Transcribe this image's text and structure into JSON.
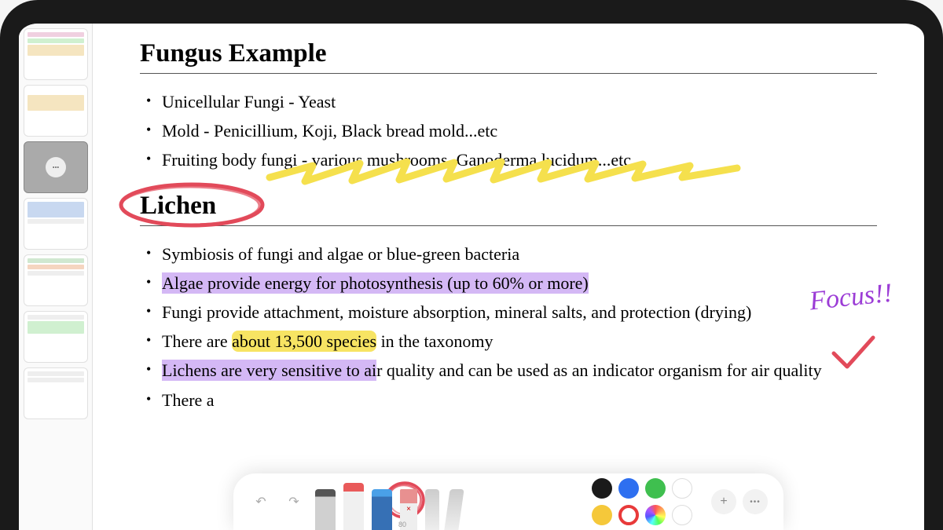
{
  "sidebar": {
    "thumbnails": [
      {
        "selected": false
      },
      {
        "selected": false
      },
      {
        "selected": true
      },
      {
        "selected": false
      },
      {
        "selected": false
      },
      {
        "selected": false
      },
      {
        "selected": false
      }
    ]
  },
  "document": {
    "section1": {
      "heading": "Fungus Example",
      "bullets": [
        "Unicellular Fungi - Yeast",
        "Mold - Penicillium, Koji, Black bread mold...etc",
        "Fruiting body fungi - various mushrooms, Ganoderma lucidum...etc"
      ]
    },
    "section2": {
      "heading": "Lichen",
      "bullets": [
        {
          "text": "Symbiosis of fungi and algae or blue-green bacteria",
          "highlight": null
        },
        {
          "text": "Algae provide energy for photosynthesis (up to 60% or more)",
          "highlight": "purple"
        },
        {
          "text_pre": "Fungi provide attachment, moisture absorption, mineral salts, and protection (drying)",
          "highlight": null
        },
        {
          "text_prefix": "There are ",
          "text_hl": "about 13,500 species",
          "text_suffix": " in the taxonomy",
          "highlight": "yellow-partial"
        },
        {
          "text_hl": "Lichens are very sensitive to ai",
          "text_suffix": "r quality and can be used as an indicator organism for air quality",
          "highlight": "purple-partial"
        },
        {
          "text": "There a",
          "highlight": null,
          "truncated": true
        }
      ]
    }
  },
  "annotations": {
    "focus_label": "Focus!!",
    "circle_color": "#e24a5a",
    "scribble_color": "#f5e04d",
    "checkmark_color": "#e24a5a"
  },
  "toolbar": {
    "undo_icon": "↶",
    "redo_icon": "↷",
    "size_label": "80",
    "tools": [
      "pencil",
      "highlighter",
      "pen",
      "eraser",
      "cutter",
      "ruler"
    ],
    "selected_tool": "highlighter",
    "colors": [
      "black",
      "blue",
      "green",
      "white",
      "yellow",
      "red-ring",
      "rainbow",
      "empty"
    ],
    "add_icon": "+",
    "more_icon": "•••"
  }
}
